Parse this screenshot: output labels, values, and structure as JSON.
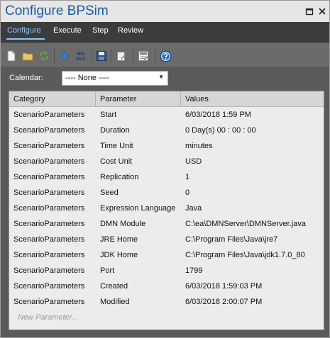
{
  "window": {
    "title": "Configure BPSim"
  },
  "tabs": [
    {
      "label": "Configure",
      "active": true
    },
    {
      "label": "Execute",
      "active": false
    },
    {
      "label": "Step",
      "active": false
    },
    {
      "label": "Review",
      "active": false
    }
  ],
  "toolbar": {
    "icons": [
      "new-document-icon",
      "open-folder-icon",
      "refresh-icon",
      "bucket-icon",
      "min-max-icon",
      "save-icon",
      "edit-icon",
      "config-icon",
      "help-icon"
    ],
    "min_max_top": "MIN",
    "min_max_bottom": "MAX"
  },
  "calendar": {
    "label": "Calendar:",
    "selected": "---- None ----"
  },
  "grid": {
    "columns": [
      "Category",
      "Parameter",
      "Values"
    ],
    "rows": [
      {
        "category": "ScenarioParameters",
        "parameter": "Start",
        "value": "6/03/2018 1:59 PM"
      },
      {
        "category": "ScenarioParameters",
        "parameter": "Duration",
        "value": "0 Day(s) 00 : 00 : 00"
      },
      {
        "category": "ScenarioParameters",
        "parameter": "Time Unit",
        "value": "minutes"
      },
      {
        "category": "ScenarioParameters",
        "parameter": "Cost Unit",
        "value": "USD"
      },
      {
        "category": "ScenarioParameters",
        "parameter": "Replication",
        "value": "1"
      },
      {
        "category": "ScenarioParameters",
        "parameter": "Seed",
        "value": "0"
      },
      {
        "category": "ScenarioParameters",
        "parameter": "Expression Language",
        "value": "Java"
      },
      {
        "category": "ScenarioParameters",
        "parameter": "DMN Module",
        "value": "C:\\ea\\DMNServer\\DMNServer.java"
      },
      {
        "category": "ScenarioParameters",
        "parameter": "JRE Home",
        "value": "C:\\Program Files\\Java\\jre7"
      },
      {
        "category": "ScenarioParameters",
        "parameter": "JDK Home",
        "value": "C:\\Program Files\\Java\\jdk1.7.0_80"
      },
      {
        "category": "ScenarioParameters",
        "parameter": "Port",
        "value": "1799"
      },
      {
        "category": "ScenarioParameters",
        "parameter": "Created",
        "value": "6/03/2018 1:59:03 PM"
      },
      {
        "category": "ScenarioParameters",
        "parameter": "Modified",
        "value": "6/03/2018 2:00:07 PM"
      }
    ],
    "new_row_placeholder": "New Parameter..."
  },
  "colors": {
    "title": "#1f5aa6",
    "active_tab": "#8ec3ff",
    "tabbar": "#3c3c3c",
    "toolbar": "#6b6b6b",
    "content": "#5a5a5a",
    "grid": "#ececec"
  }
}
